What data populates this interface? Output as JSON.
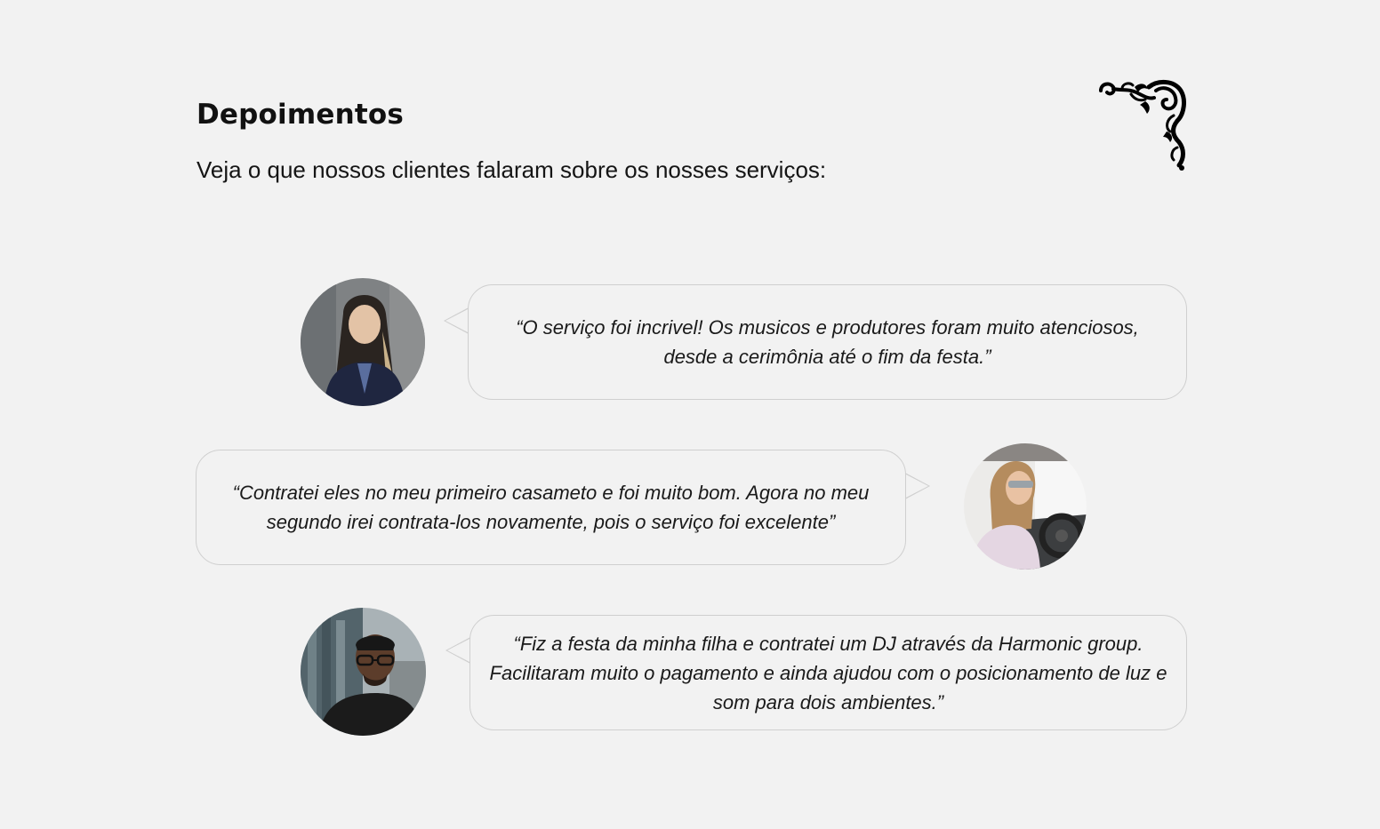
{
  "section": {
    "title": "Depoimentos",
    "subtitle": "Veja o que nossos clientes falaram sobre os nosses serviços:",
    "ornament_icon": "floral-corner-ornament-icon"
  },
  "testimonials": [
    {
      "quote": "“O serviço foi incrivel! Os musicos e produtores foram muito atenciosos, desde a cerimônia até o fim da festa.”",
      "avatar_icon": "customer-photo-avatar"
    },
    {
      "quote": "“Contratei eles no meu primeiro casameto e foi muito bom. Agora no meu segundo irei contrata-los novamente, pois o serviço foi excelente”",
      "avatar_icon": "customer-photo-avatar"
    },
    {
      "quote": "“Fiz a festa da minha filha e contratei um DJ através da Harmonic group. Facilitaram muito o pagamento e ainda ajudou com o posicionamento de luz e som para dois ambientes.”",
      "avatar_icon": "customer-photo-avatar"
    }
  ],
  "colors": {
    "background": "#f2f2f2",
    "bubble_border": "#cfcfcf",
    "text": "#111111"
  }
}
